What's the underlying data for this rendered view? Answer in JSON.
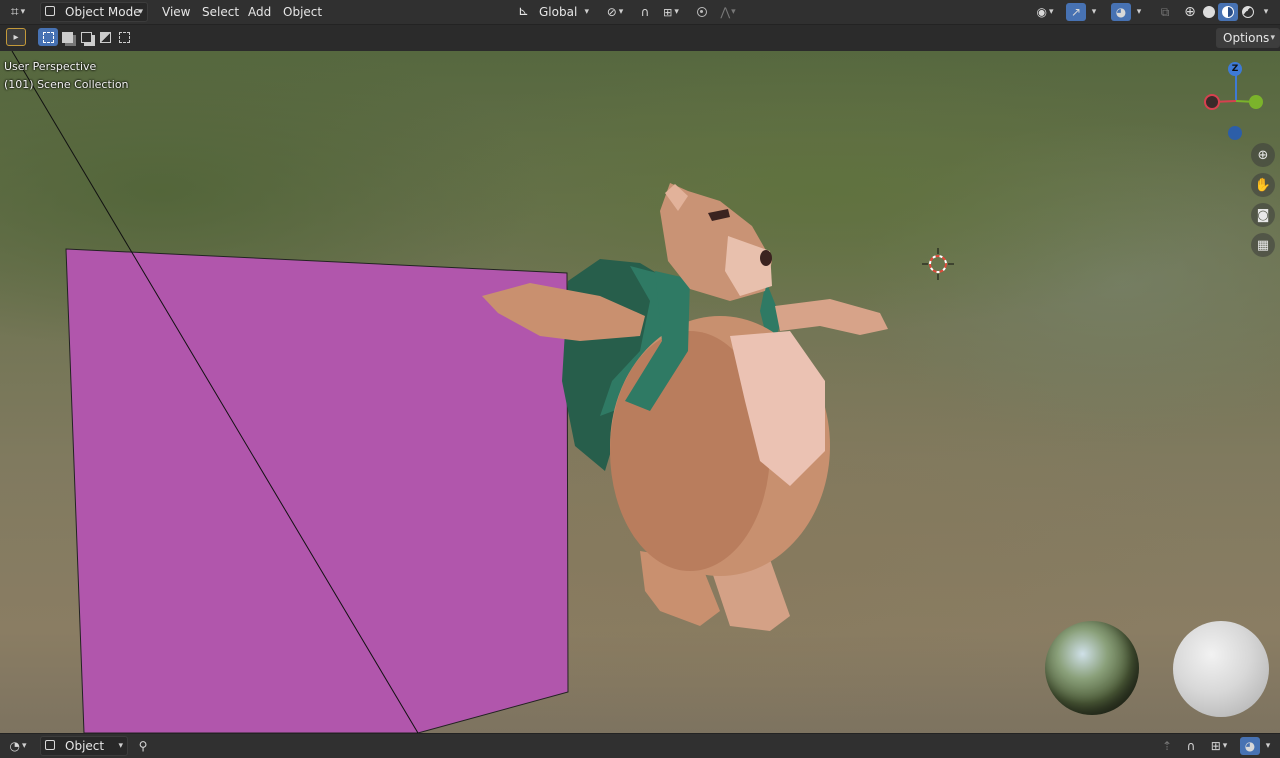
{
  "header": {
    "mode_label": "Object Mode",
    "menus": [
      "View",
      "Select",
      "Add",
      "Object"
    ],
    "transform_orientation": "Global"
  },
  "toolbar": {
    "options_label": "Options"
  },
  "viewport": {
    "view_name": "User Perspective",
    "collection_info": "(101) Scene Collection",
    "gizmo_z_label": "Z"
  },
  "footer": {
    "mode_label": "Object"
  },
  "colors": {
    "accent": "#4772b3",
    "plane": "#b156ac",
    "axis_x": "#d7404f",
    "axis_y": "#7bb32b",
    "axis_z": "#3e7ad6"
  },
  "icons": [
    "editor-type-icon",
    "object-mode-icon",
    "transform-orientation-icon",
    "snap-icon",
    "proportional-edit-icon",
    "falloff-icon",
    "visibility-icon",
    "gizmo-icon",
    "overlay-icon",
    "xray-icon",
    "wireframe-shading-icon",
    "solid-shading-icon",
    "material-shading-icon",
    "rendered-shading-icon",
    "select-box-icon",
    "zoom-icon",
    "hand-pan-icon",
    "camera-icon",
    "grid-ortho-icon",
    "pin-icon"
  ]
}
